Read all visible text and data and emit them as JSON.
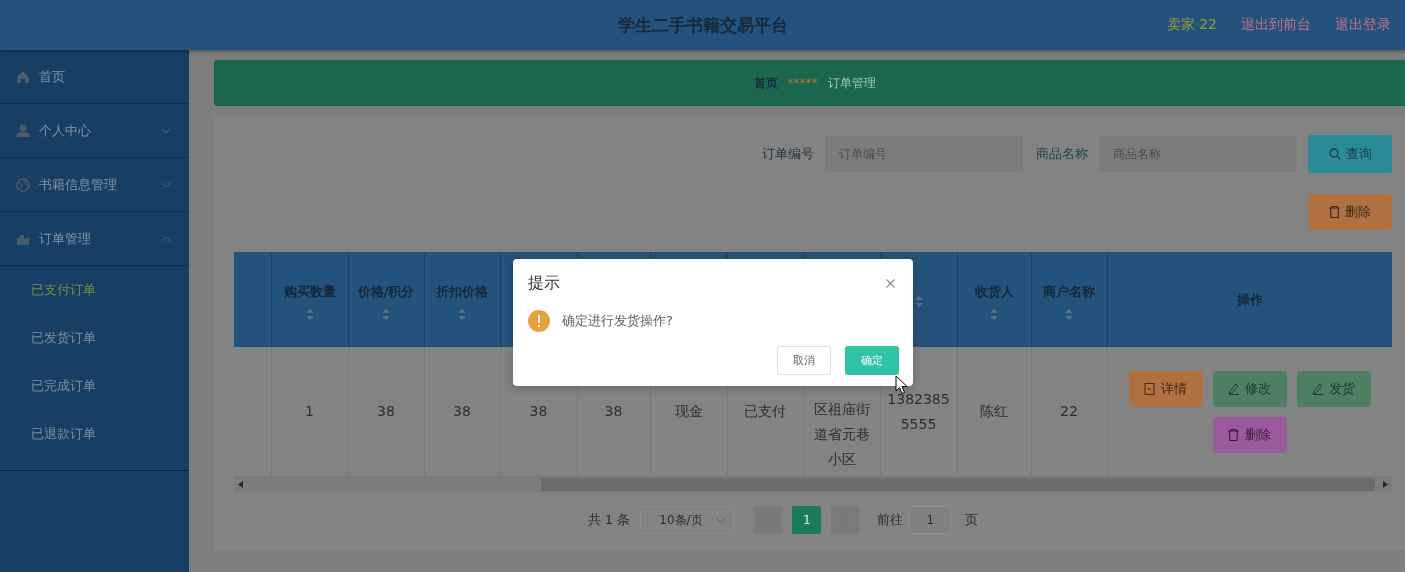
{
  "header": {
    "title": "学生二手书籍交易平台",
    "user": "卖家 22",
    "links": [
      "退出到前台",
      "退出登录"
    ]
  },
  "sidebar": {
    "items": [
      {
        "label": "首页",
        "kind": "link"
      },
      {
        "label": "个人中心",
        "kind": "menu",
        "expanded": false
      },
      {
        "label": "书籍信息管理",
        "kind": "menu",
        "expanded": false
      },
      {
        "label": "订单管理",
        "kind": "menu",
        "expanded": true,
        "children": [
          {
            "label": "已支付订单",
            "selected": true
          },
          {
            "label": "已发货订单",
            "selected": false
          },
          {
            "label": "已完成订单",
            "selected": false
          },
          {
            "label": "已退款订单",
            "selected": false
          }
        ]
      }
    ]
  },
  "breadcrumb": {
    "home": "首页",
    "separator": "*****",
    "current": "订单管理"
  },
  "search": {
    "fields": [
      {
        "label": "订单编号",
        "placeholder": "订单编号"
      },
      {
        "label": "商品名称",
        "placeholder": "商品名称"
      }
    ],
    "search_button": "查询",
    "delete_button": "删除"
  },
  "table": {
    "columns": [
      {
        "kind": "plain"
      },
      {
        "label": "购买数量",
        "kind": "sortable"
      },
      {
        "label": "价格/积分",
        "kind": "sortable"
      },
      {
        "label": "折扣价格",
        "kind": "sortable"
      },
      {
        "kind": "plain"
      },
      {
        "kind": "plain"
      },
      {
        "kind": "plain"
      },
      {
        "kind": "plain"
      },
      {
        "kind": "plain"
      },
      {
        "kind": "sortable"
      },
      {
        "label": "收货人",
        "kind": "sortable"
      },
      {
        "label": "商户名称",
        "kind": "sortable"
      },
      {
        "label": "操作",
        "kind": "plain"
      }
    ],
    "rows": [
      {
        "cells": [
          "",
          "1",
          "38",
          "38",
          "38",
          "38",
          "现金",
          "已支付",
          "区祖庙街道省元巷小区",
          "13823855555",
          "陈红",
          "22"
        ],
        "actions": [
          {
            "label": "详情",
            "kind": "detail"
          },
          {
            "label": "修改",
            "kind": "edit"
          },
          {
            "label": "发货",
            "kind": "edit"
          },
          {
            "label": "删除",
            "kind": "delete"
          }
        ]
      }
    ]
  },
  "pagination": {
    "total": "共 1 条",
    "page_size": "10条/页",
    "pages": [
      {
        "label": "1",
        "selected": true
      }
    ],
    "goto_label": "前往",
    "goto_value": "1",
    "goto_suffix": "页"
  },
  "dialog": {
    "title": "提示",
    "message": "确定进行发货操作?",
    "buttons": [
      {
        "label": "取消",
        "kind": "cancel"
      },
      {
        "label": "确定",
        "kind": "confirm"
      }
    ]
  }
}
